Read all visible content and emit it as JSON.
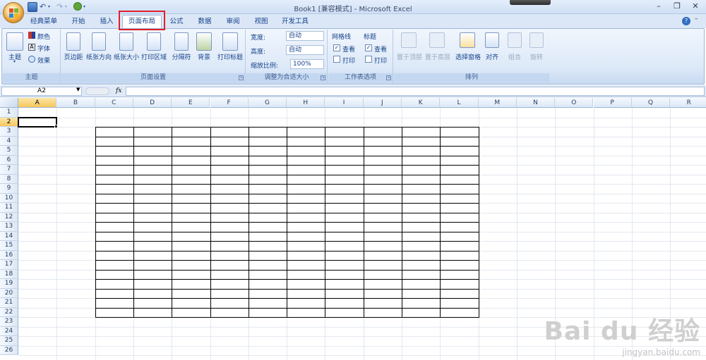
{
  "window": {
    "title": "Book1  [兼容模式] - Microsoft Excel",
    "minimize": "–",
    "restore": "❐",
    "close": "✕"
  },
  "tabs": [
    {
      "label": "经典菜单"
    },
    {
      "label": "开始"
    },
    {
      "label": "插入"
    },
    {
      "label": "页面布局"
    },
    {
      "label": "公式"
    },
    {
      "label": "数据"
    },
    {
      "label": "审阅"
    },
    {
      "label": "视图"
    },
    {
      "label": "开发工具"
    }
  ],
  "active_tab": "页面布局",
  "ribbon": {
    "theme": {
      "themes_label": "主题",
      "colors_label": "颜色",
      "fonts_label": "字体",
      "effects_label": "效果",
      "group_label": "主题"
    },
    "page_setup": {
      "margins": "页边距",
      "orientation": "纸张方向",
      "size": "纸张大小",
      "print_area": "打印区域",
      "breaks": "分隔符",
      "background": "背景",
      "print_titles": "打印标题",
      "group_label": "页面设置"
    },
    "scale": {
      "width_label": "宽度:",
      "width_value": "自动",
      "height_label": "高度:",
      "height_value": "自动",
      "scale_label": "缩放比例:",
      "scale_value": "100%",
      "group_label": "调整为合适大小"
    },
    "sheet_options": {
      "gridlines_label": "网格线",
      "headings_label": "标题",
      "view_label": "查看",
      "print_label": "打印",
      "group_label": "工作表选项"
    },
    "arrange": {
      "bring_front": "置于顶层",
      "send_back": "置于底层",
      "selection_pane": "选择窗格",
      "align": "对齐",
      "group": "组合",
      "rotate": "旋转",
      "group_label": "排列"
    }
  },
  "formula_bar": {
    "name_box": "A2",
    "fx": "fx",
    "formula": ""
  },
  "sheet": {
    "columns": [
      "A",
      "B",
      "C",
      "D",
      "E",
      "F",
      "G",
      "H",
      "I",
      "J",
      "K",
      "L",
      "M",
      "N",
      "O",
      "P",
      "Q",
      "R"
    ],
    "rows": [
      "1",
      "2",
      "3",
      "4",
      "5",
      "6",
      "7",
      "8",
      "9",
      "10",
      "11",
      "12",
      "13",
      "14",
      "15",
      "16",
      "17",
      "18",
      "19",
      "20",
      "21",
      "22",
      "23",
      "24",
      "25",
      "26"
    ],
    "selected_cell": "A2"
  },
  "watermark": {
    "brand": "Bai du 经验",
    "url": "jingyan.baidu.com"
  }
}
